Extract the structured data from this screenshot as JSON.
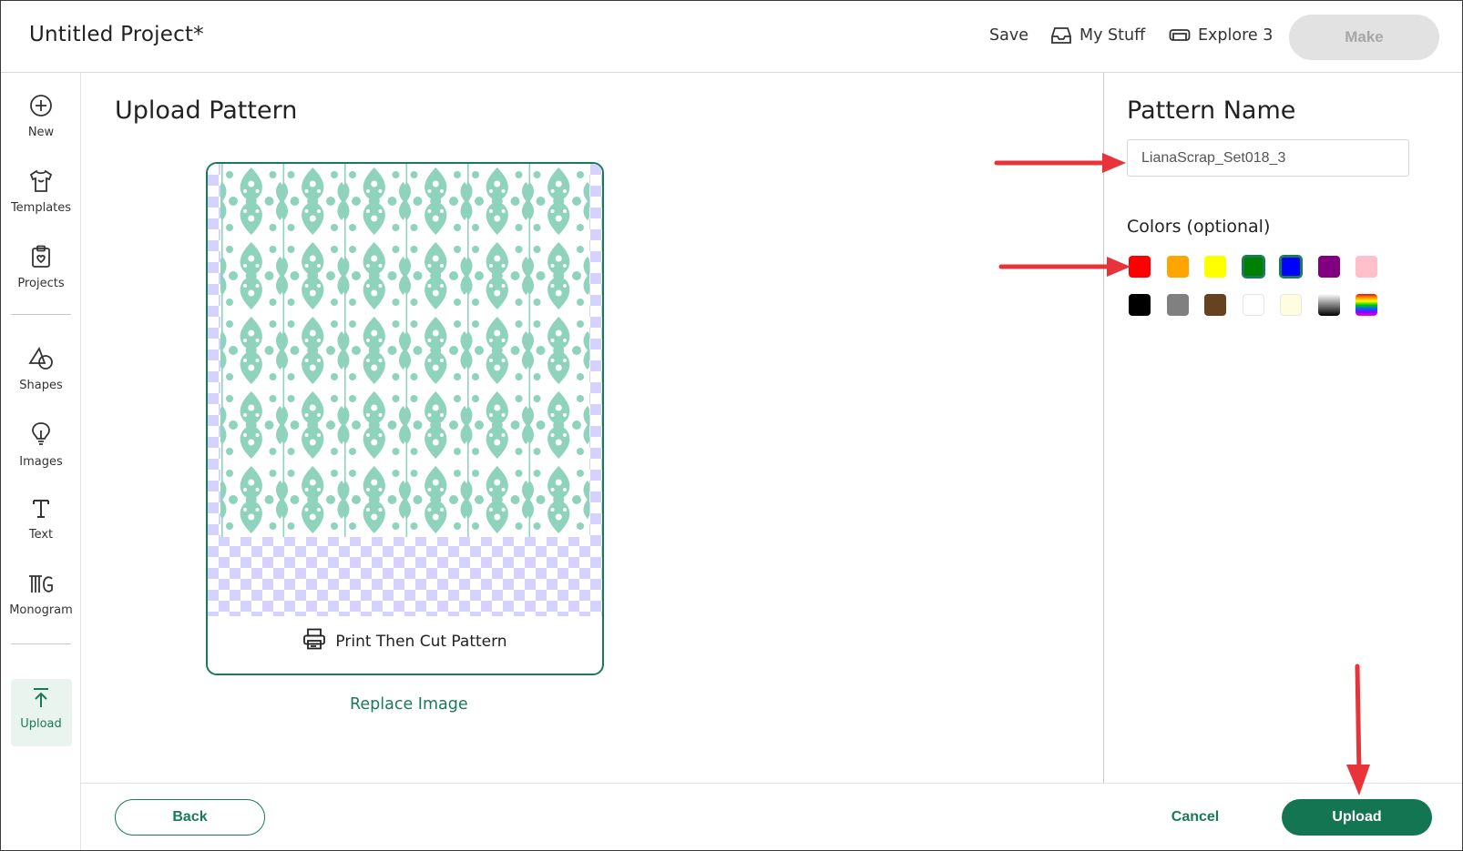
{
  "header": {
    "project_title": "Untitled Project*",
    "save_label": "Save",
    "my_stuff_label": "My Stuff",
    "machine_label": "Explore 3",
    "make_label": "Make"
  },
  "sidebar": {
    "items": [
      {
        "label": "New",
        "icon": "plus-circle-icon"
      },
      {
        "label": "Templates",
        "icon": "tshirt-icon"
      },
      {
        "label": "Projects",
        "icon": "clipboard-heart-icon"
      },
      {
        "label": "Shapes",
        "icon": "shapes-icon"
      },
      {
        "label": "Images",
        "icon": "lightbulb-icon"
      },
      {
        "label": "Text",
        "icon": "text-t-icon"
      },
      {
        "label": "Monogram",
        "icon": "monogram-icon"
      },
      {
        "label": "Upload",
        "icon": "upload-arrow-icon",
        "active": true
      }
    ]
  },
  "main": {
    "title": "Upload Pattern",
    "card_label": "Print Then Cut Pattern",
    "replace_label": "Replace Image"
  },
  "right_panel": {
    "title": "Pattern Name",
    "pattern_name_value": "LianaScrap_Set018_3",
    "colors_label": "Colors (optional)",
    "colors": [
      {
        "name": "red",
        "hex": "#ff0000"
      },
      {
        "name": "orange",
        "hex": "#ffa500"
      },
      {
        "name": "yellow",
        "hex": "#ffff00"
      },
      {
        "name": "green",
        "hex": "#008000",
        "selected": true
      },
      {
        "name": "blue",
        "hex": "#0000ff",
        "selected": true
      },
      {
        "name": "purple",
        "hex": "#800080"
      },
      {
        "name": "pink",
        "hex": "#ffc0cb"
      },
      {
        "name": "black",
        "hex": "#000000"
      },
      {
        "name": "gray",
        "hex": "#808080"
      },
      {
        "name": "brown",
        "hex": "#654321"
      },
      {
        "name": "white",
        "hex": "#ffffff"
      },
      {
        "name": "cream",
        "hex": "#fffde0"
      },
      {
        "name": "black-white-gradient",
        "hex": "gradient"
      },
      {
        "name": "rainbow",
        "hex": "rainbow"
      }
    ]
  },
  "footer": {
    "back_label": "Back",
    "cancel_label": "Cancel",
    "upload_label": "Upload"
  },
  "theme": {
    "accent": "#1a7a55",
    "pattern_color": "#8fd3bd",
    "annotation_arrow": "#e8333a"
  }
}
